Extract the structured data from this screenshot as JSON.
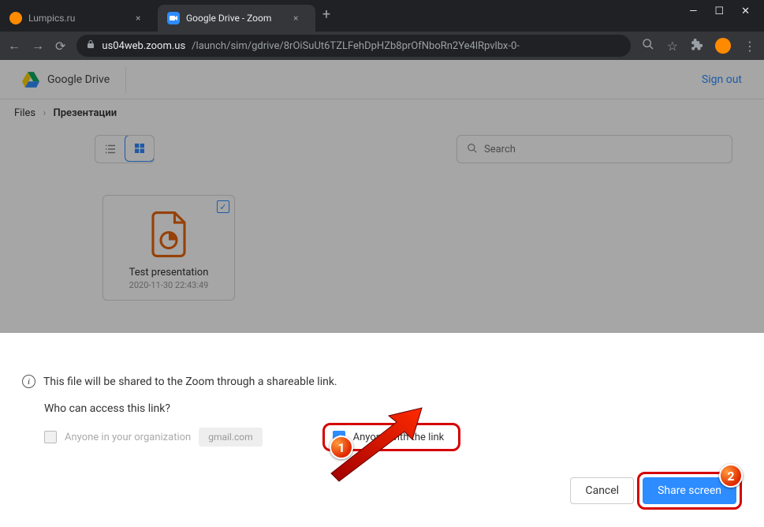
{
  "chrome": {
    "tabs": [
      {
        "title": "Lumpics.ru",
        "active": false
      },
      {
        "title": "Google Drive - Zoom",
        "active": true
      }
    ],
    "url_host": "us04web.zoom.us",
    "url_path": "/launch/sim/gdrive/8rOiSuUt6TZLFehDpHZb8prOfNboRn2Ye4lRpvlbx-0-"
  },
  "drive": {
    "app_name": "Google Drive",
    "signout": "Sign out",
    "breadcrumb_root": "Files",
    "breadcrumb_current": "Презентации",
    "search_placeholder": "Search"
  },
  "file": {
    "name": "Test presentation",
    "date": "2020-11-30 22:43:49"
  },
  "share": {
    "note": "This file will be shared to the Zoom through a shareable link.",
    "who_label": "Who can access this link?",
    "opt_org": "Anyone in your organization",
    "org_chip": "gmail.com",
    "opt_link": "Anyone with the link",
    "cancel": "Cancel",
    "confirm": "Share screen"
  },
  "badges": {
    "one": "1",
    "two": "2"
  }
}
